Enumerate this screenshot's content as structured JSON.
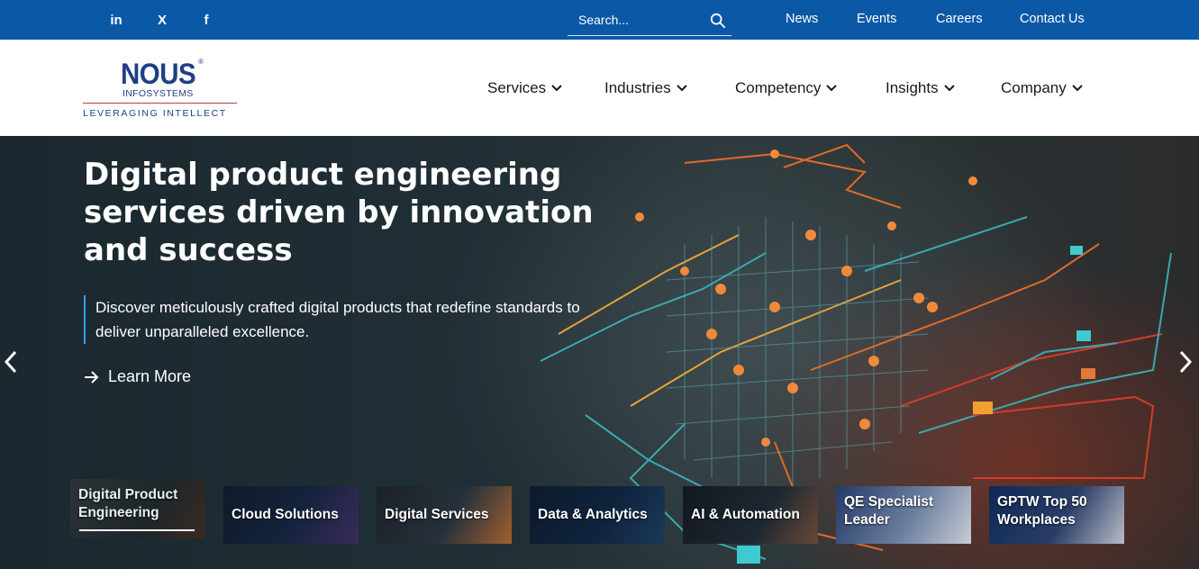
{
  "topbar": {
    "social": [
      {
        "icon": "linkedin-icon",
        "glyph": "in"
      },
      {
        "icon": "x-icon",
        "glyph": "X"
      },
      {
        "icon": "facebook-icon",
        "glyph": "f"
      }
    ],
    "search_placeholder": "Search...",
    "links": [
      "News",
      "Events",
      "Careers",
      "Contact Us"
    ],
    "background": "#0b58a6"
  },
  "logo": {
    "name": "NOUS",
    "sub": "INFOSYSTEMS",
    "tagline": "LEVERAGING INTELLECT",
    "reg": "®",
    "color": "#1f3f86"
  },
  "nav": [
    "Services",
    "Industries",
    "Competency",
    "Insights",
    "Company"
  ],
  "hero": {
    "title": "Digital product engineering services driven by innovation and success",
    "description": "Discover meticulously crafted digital products that redefine standards to deliver unparalleled excellence.",
    "cta": "Learn More",
    "accent": "#2aa7e0"
  },
  "cards": [
    {
      "label": "Digital Product Engineering",
      "active": true
    },
    {
      "label": "Cloud Solutions",
      "active": false
    },
    {
      "label": "Digital Services",
      "active": false
    },
    {
      "label": "Data & Analytics",
      "active": false
    },
    {
      "label": "AI & Automation",
      "active": false
    },
    {
      "label": "QE Specialist Leader",
      "active": false
    },
    {
      "label": "GPTW Top 50 Workplaces",
      "active": false
    }
  ]
}
